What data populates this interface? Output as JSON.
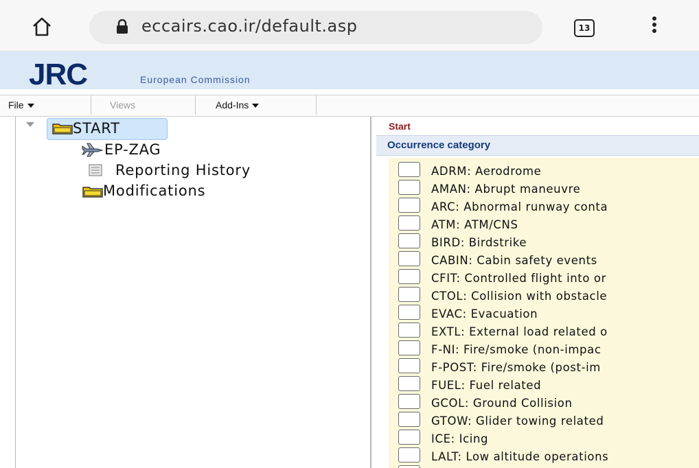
{
  "browser": {
    "url": "eccairs.cao.ir/default.asp",
    "tab_count": "13",
    "home_icon": "home-icon",
    "lock_icon": "lock-icon",
    "menu_icon": "kebab-menu-icon"
  },
  "banner": {
    "logo": "JRC",
    "subtitle": "European Commission"
  },
  "menubar": {
    "items": [
      {
        "label": "File",
        "has_caret": true,
        "enabled": true
      },
      {
        "label": "Views",
        "has_caret": false,
        "enabled": false
      },
      {
        "label": "Add-Ins",
        "has_caret": true,
        "enabled": true
      }
    ]
  },
  "tree": {
    "root": {
      "label": "START",
      "icon": "folder-icon",
      "selected": true,
      "expanded": true
    },
    "children": [
      {
        "label": "EP-ZAG",
        "icon": "airplane-icon"
      },
      {
        "label": "Reporting History",
        "icon": "history-icon"
      },
      {
        "label": "Modifications",
        "icon": "folder-icon"
      }
    ]
  },
  "panel": {
    "section_label": "Start",
    "header": "Occurrence category",
    "categories": [
      "ADRM: Aerodrome",
      "AMAN: Abrupt maneuvre",
      "ARC: Abnormal runway conta",
      "ATM: ATM/CNS",
      "BIRD: Birdstrike",
      "CABIN: Cabin safety events",
      "CFIT: Controlled flight into or",
      "CTOL: Collision with obstacle",
      "EVAC: Evacuation",
      "EXTL: External load related o",
      "F-NI: Fire/smoke (non-impac",
      "F-POST: Fire/smoke (post-im",
      "FUEL: Fuel related",
      "GCOL: Ground Collision",
      "GTOW: Glider towing related",
      "ICE: Icing",
      "LALT: Low altitude operations"
    ]
  },
  "colors": {
    "banner_bg": "#dbe8f6",
    "logo": "#0b2a66",
    "section_label": "#8b1a1a",
    "header_text": "#143b7a",
    "checklist_bg": "#fbf8dc",
    "selected_node_bg": "#cfe6fb"
  }
}
